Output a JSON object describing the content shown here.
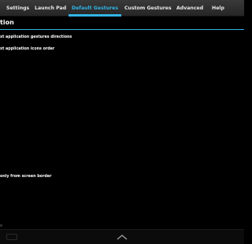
{
  "tabs": [
    {
      "label": "Settings",
      "selected": false
    },
    {
      "label": "Launch Pad",
      "selected": false
    },
    {
      "label": "Default Gestures",
      "selected": true
    },
    {
      "label": "Custom Gestures",
      "selected": false
    },
    {
      "label": "Advanced",
      "selected": false
    },
    {
      "label": "Help",
      "selected": false
    }
  ],
  "section": {
    "title": "tion"
  },
  "preferences": [
    {
      "label": "xt application gestures directions"
    },
    {
      "label": "xt application icons order"
    },
    {
      "label": "only from screen border"
    }
  ],
  "nav": {
    "icons": [
      "recent-apps-icon",
      "chevron-up-icon"
    ],
    "edge_mark": "v"
  },
  "colors": {
    "accent": "#33b5e5",
    "background": "#000000",
    "tabbar": "#2e2e2e"
  }
}
